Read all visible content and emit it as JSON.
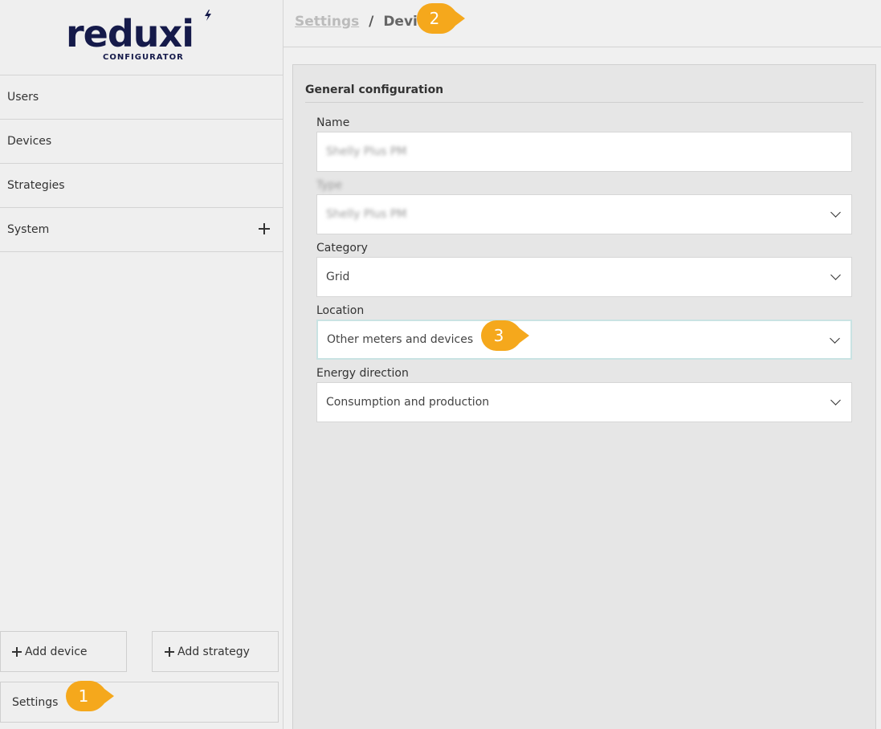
{
  "brand": {
    "name": "reduxi",
    "subtitle": "CONFIGURATOR"
  },
  "sidebar": {
    "items": [
      {
        "label": "Users"
      },
      {
        "label": "Devices"
      },
      {
        "label": "Strategies"
      },
      {
        "label": "System"
      }
    ],
    "add_device_label": "Add device",
    "add_strategy_label": "Add strategy",
    "settings_label": "Settings"
  },
  "header": {
    "breadcrumb_parent": "Settings",
    "breadcrumb_separator": "/",
    "breadcrumb_current": "Device"
  },
  "form": {
    "section_title": "General configuration",
    "name": {
      "label": "Name",
      "value": "Shelly Plus PM"
    },
    "type": {
      "label": "Type",
      "value": "Shelly Plus PM"
    },
    "category": {
      "label": "Category",
      "value": "Grid"
    },
    "location": {
      "label": "Location",
      "value": "Other meters and devices"
    },
    "energy_direction": {
      "label": "Energy direction",
      "value": "Consumption and production"
    }
  },
  "callouts": [
    "1",
    "2",
    "3"
  ],
  "colors": {
    "brand": "#151a4a",
    "callout": "#f5a81c",
    "focus_border": "#c9e3e3"
  },
  "icons": [
    "plus-icon",
    "chevron-down-icon",
    "bolt-icon"
  ]
}
